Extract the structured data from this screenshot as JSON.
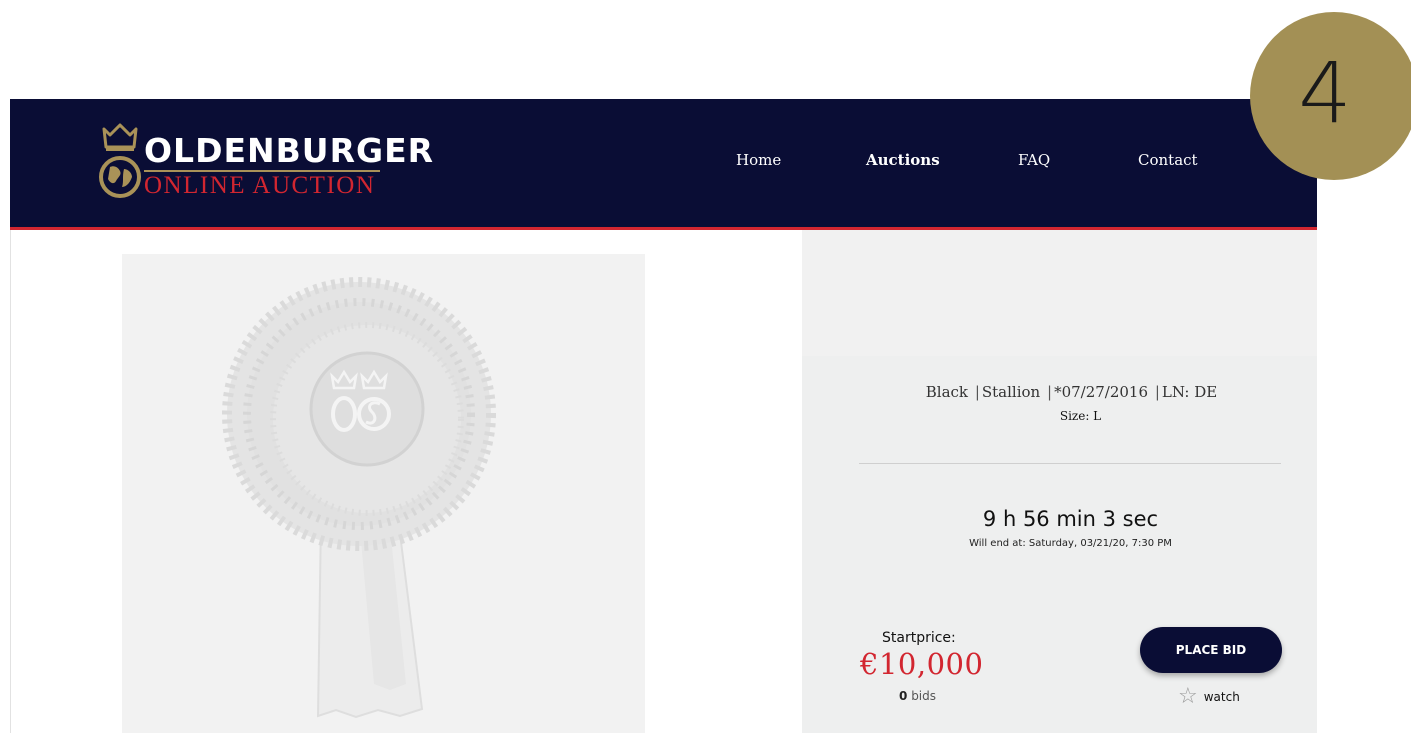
{
  "brand": {
    "name_top": "OLDENBURGER",
    "name_bottom": "ONLINE AUCTION",
    "gold": "#a99258",
    "red": "#d22630",
    "navy": "#0a0d35"
  },
  "nav": {
    "items": [
      {
        "label": "Home"
      },
      {
        "label": "Auctions",
        "active": true
      },
      {
        "label": "FAQ"
      },
      {
        "label": "Contact"
      }
    ]
  },
  "step_badge": {
    "label": "4",
    "color": "#a39055"
  },
  "product": {
    "image_icon": "rosette-ribbon-image",
    "attributes": {
      "color": "Black",
      "sex": "Stallion",
      "birth": "*07/27/2016",
      "ln": "LN: DE",
      "separator": "|"
    },
    "size": "Size: L"
  },
  "auction": {
    "countdown": "9 h 56 min 3 sec",
    "end_text": "Will end at: Saturday, 03/21/20, 7:30 PM",
    "startprice_label": "Startprice:",
    "price": "€10,000",
    "bids_count": "0",
    "bids_label": "bids",
    "place_bid_label": "PLACE BID",
    "watch_label": "watch",
    "watch_icon": "star-outline-icon"
  }
}
